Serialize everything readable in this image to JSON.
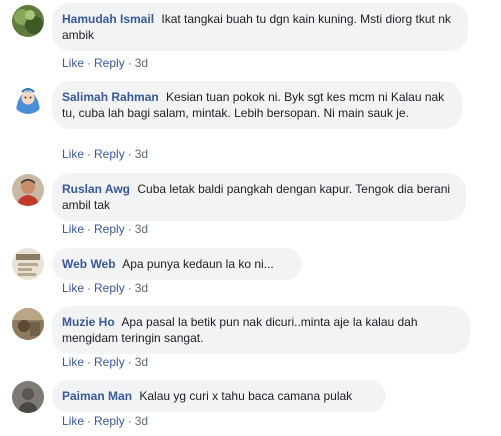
{
  "actions": {
    "like": "Like",
    "reply": "Reply",
    "separator": "·"
  },
  "comments": [
    {
      "author": "Hamudah Ismail",
      "text": "Ikat tangkai buah tu dgn kain kuning. Msti diorg tkut nk ambik",
      "time": "3d",
      "avatar_icon": "plant-photo-avatar-icon"
    },
    {
      "author": "Salimah Rahman",
      "text": "Kesian tuan pokok ni. Byk sgt kes mcm ni Kalau nak tu, cuba lah bagi salam, mintak. Lebih bersopan. Ni main sauk je.",
      "time": "3d",
      "avatar_icon": "cartoon-hijab-avatar-icon"
    },
    {
      "author": "Ruslan Awg",
      "text": "Cuba letak baldi pangkah dengan kapur. Tengok dia berani ambil tak",
      "time": "3d",
      "avatar_icon": "person-photo-avatar-icon"
    },
    {
      "author": "Web Web",
      "text": "Apa punya kedaun la ko ni...",
      "time": "3d",
      "avatar_icon": "poster-avatar-icon"
    },
    {
      "author": "Muzie Ho",
      "text": "Apa pasal la betik pun nak dicuri..minta aje la kalau dah mengidam teringin sangat.",
      "time": "3d",
      "avatar_icon": "outdoor-photo-avatar-icon"
    },
    {
      "author": "Paiman Man",
      "text": "Kalau yg curi x tahu baca camana pulak",
      "time": "3d",
      "avatar_icon": "grey-photo-avatar-icon"
    }
  ],
  "colors": {
    "author": "#385898",
    "bubble": "#f2f3f5",
    "meta": "#606770"
  }
}
